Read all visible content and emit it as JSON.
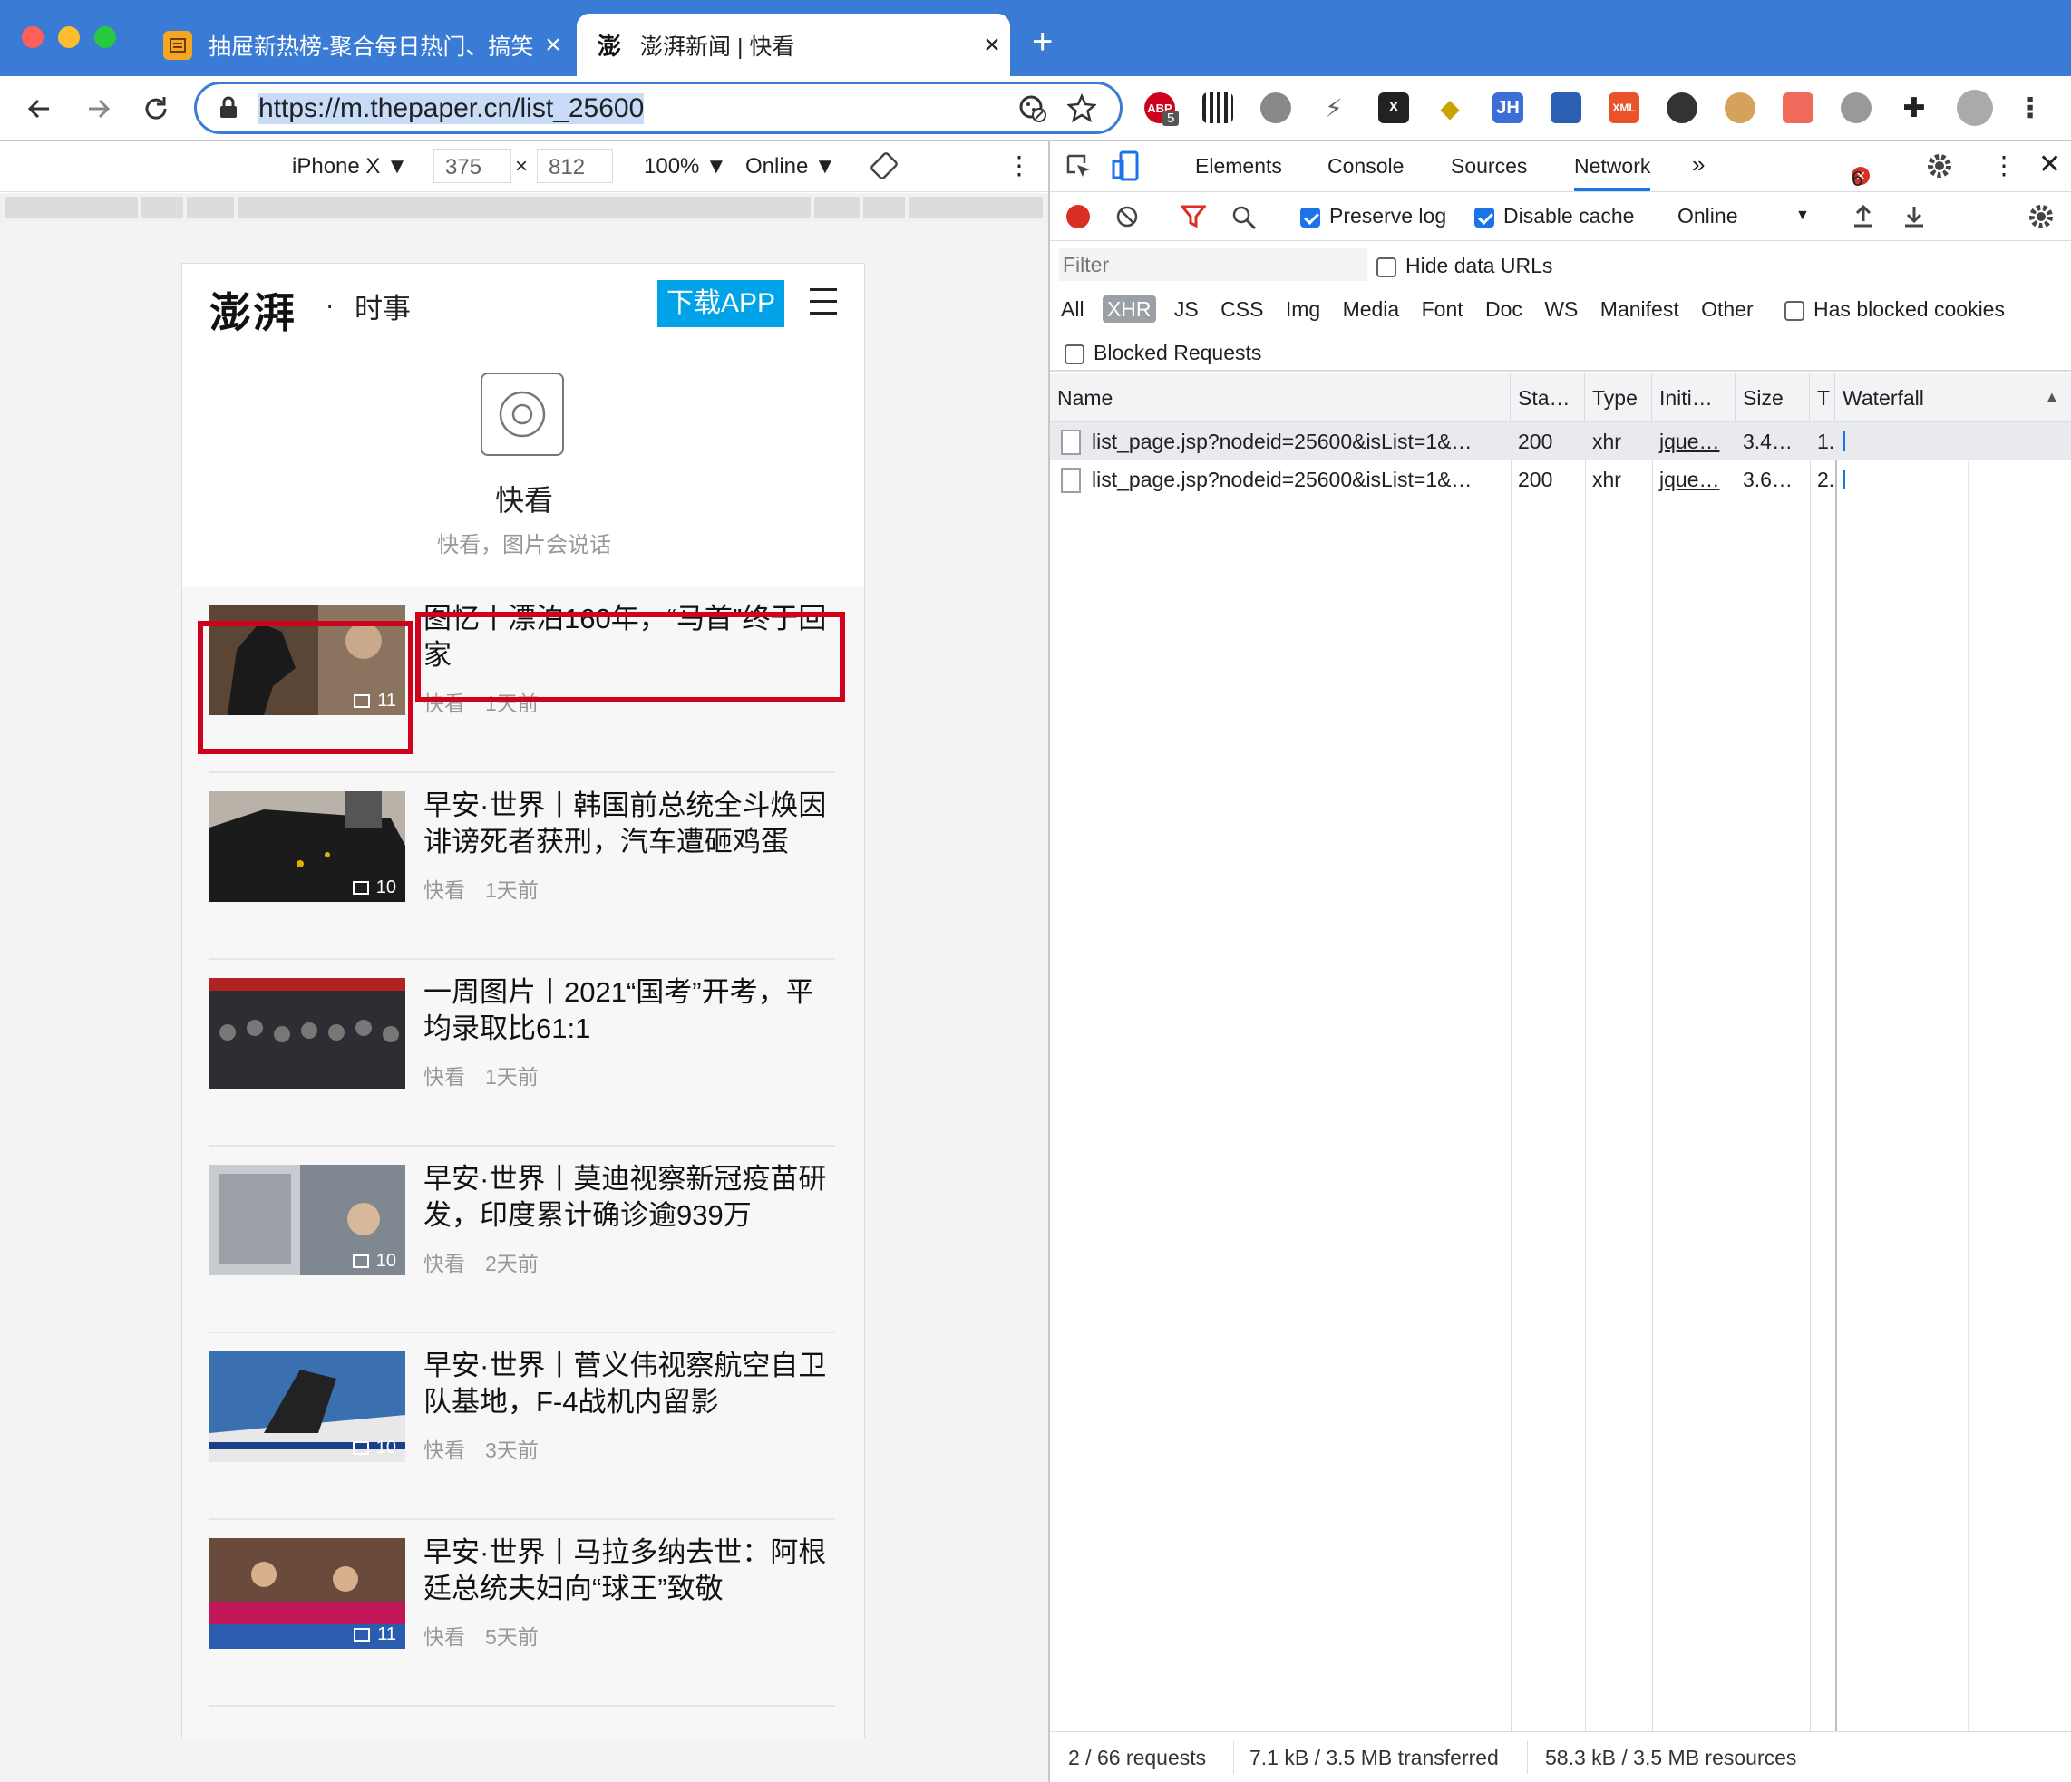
{
  "tabs": [
    {
      "title": "抽屉新热榜-聚合每日热门、搞笑",
      "close": "×"
    },
    {
      "title": "澎湃新闻 | 快看",
      "close": "×"
    }
  ],
  "newtab": "+",
  "address": {
    "url": "https://m.thepaper.cn/list_25600"
  },
  "extensions": {
    "abp_badge": "5",
    "jh": "JH",
    "xml": "XML",
    "x": "X"
  },
  "device_toolbar": {
    "device": "iPhone X ▼",
    "width": "375",
    "times": "×",
    "height": "812",
    "zoom": "100% ▼",
    "throttle": "Online ▼"
  },
  "page": {
    "logo": "澎湃",
    "dot": "·",
    "channel": "时事",
    "download": "下载APP",
    "hero_title": "快看",
    "hero_desc": "快看，图片会说话",
    "items": [
      {
        "title": "图忆丨漂泊160年，“马首”终于回家",
        "source": "快看",
        "time": "1天前",
        "count": "11"
      },
      {
        "title": "早安·世界丨韩国前总统全斗焕因诽谤死者获刑，汽车遭砸鸡蛋",
        "source": "快看",
        "time": "1天前",
        "count": "10"
      },
      {
        "title": "一周图片丨2021“国考”开考，平均录取比61:1",
        "source": "快看",
        "time": "1天前",
        "count": ""
      },
      {
        "title": "早安·世界丨莫迪视察新冠疫苗研发，印度累计确诊逾939万",
        "source": "快看",
        "time": "2天前",
        "count": "10"
      },
      {
        "title": "早安·世界丨菅义伟视察航空自卫队基地，F-4战机内留影",
        "source": "快看",
        "time": "3天前",
        "count": "10"
      },
      {
        "title": "早安·世界丨马拉多纳去世：阿根廷总统夫妇向“球王”致敬",
        "source": "快看",
        "time": "5天前",
        "count": "11"
      }
    ]
  },
  "devtools": {
    "tabs": [
      "Elements",
      "Console",
      "Sources",
      "Network",
      "»"
    ],
    "error_count": "6",
    "preserve_log": "Preserve log",
    "disable_cache": "Disable cache",
    "throttle": "Online",
    "filter_placeholder": "Filter",
    "hide_data_urls": "Hide data URLs",
    "types": [
      "All",
      "XHR",
      "JS",
      "CSS",
      "Img",
      "Media",
      "Font",
      "Doc",
      "WS",
      "Manifest",
      "Other"
    ],
    "has_blocked_cookies": "Has blocked cookies",
    "blocked_requests": "Blocked Requests",
    "columns": {
      "name": "Name",
      "status": "Sta…",
      "type": "Type",
      "initiator": "Initi…",
      "size": "Size",
      "time": "T",
      "waterfall": "Waterfall"
    },
    "rows": [
      {
        "name": "list_page.jsp?nodeid=25600&isList=1&…",
        "status": "200",
        "type": "xhr",
        "initiator": "jque…",
        "size": "3.4…",
        "time": "1."
      },
      {
        "name": "list_page.jsp?nodeid=25600&isList=1&…",
        "status": "200",
        "type": "xhr",
        "initiator": "jque…",
        "size": "3.6…",
        "time": "2."
      }
    ],
    "footer": {
      "requests": "2 / 66 requests",
      "transferred": "7.1 kB / 3.5 MB transferred",
      "resources": "58.3 kB / 3.5 MB resources"
    }
  },
  "colors": {
    "chrome_blue": "#3a7bd5",
    "download_btn": "#00a3e8",
    "highlight_red": "#d0021b",
    "record_red": "#d93025"
  }
}
